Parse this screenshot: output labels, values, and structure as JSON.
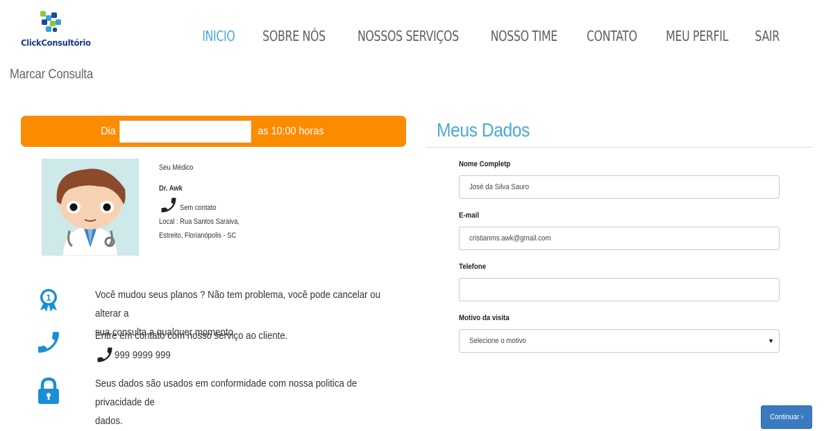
{
  "logo": {
    "text": "ClickConsultório"
  },
  "nav": {
    "items": [
      {
        "label": "INICIO",
        "active": true
      },
      {
        "label": "SOBRE NÓS"
      },
      {
        "label": "NOSSOS SERVIÇOS"
      },
      {
        "label": "NOSSO TIME"
      },
      {
        "label": "CONTATO"
      },
      {
        "label": "MEU PERFIL"
      },
      {
        "label": "SAIR"
      }
    ]
  },
  "page": {
    "title": "Marcar Consulta"
  },
  "appointment": {
    "prefix": "Dia",
    "date_value": "",
    "suffix": "as 10:00 horas"
  },
  "doctor": {
    "section_label": "Seu Médico",
    "name": "Dr. Awk",
    "contact": "Sem contato",
    "address_line1": "Local : Rua Santos Saraiva,",
    "address_line2": "Estreito, Florianópolis - SC"
  },
  "info": {
    "plans_text1": "Você mudou seus planos ? Não tem problema, você pode cancelar ou alterar a",
    "plans_text2": "sua consulta a qualquer momento.",
    "contact_text": "Entre em contato com nosso serviço ao cliente.",
    "phone": "999 9999 999",
    "privacy_text1": "Seus dados são usados em conformidade com nossa politica de privacidade de",
    "privacy_text2": "dados."
  },
  "form": {
    "title": "Meus Dados",
    "name_label": "Nome Completp",
    "name_value": "José da Silva Sauro",
    "email_label": "E-mail",
    "email_value": "cristianms.awk@gmail.com",
    "phone_label": "Telefone",
    "phone_value": "",
    "reason_label": "Motivo da visita",
    "reason_value": "Selecione o motivo",
    "submit_label": "Continuar ›"
  },
  "colors": {
    "accent": "#4aa9d8",
    "orange": "#fb8c00",
    "button": "#3a7bbf",
    "icon_blue": "#1a8fd6"
  },
  "icons": [
    "logo-mark-icon",
    "award-ribbon-icon",
    "phone-icon",
    "lock-icon"
  ]
}
